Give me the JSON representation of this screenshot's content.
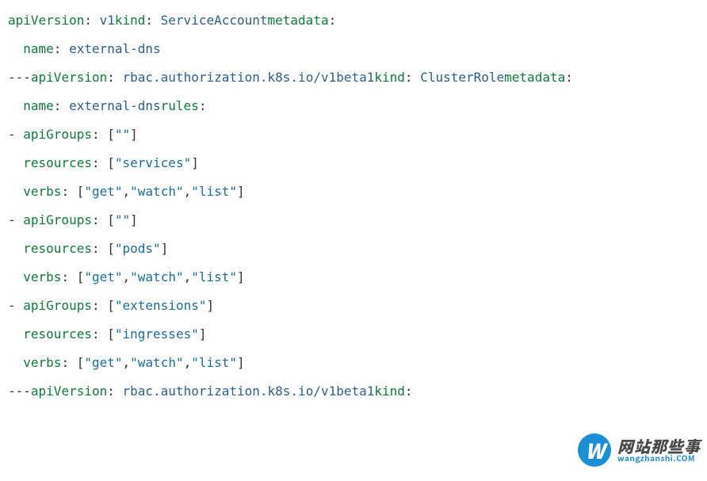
{
  "code": {
    "line1": {
      "k1": "apiVersion",
      "c1": ": ",
      "v1": "v1",
      "k2": "kind",
      "c2": ": ",
      "v2": "ServiceAccount",
      "k3": "metadata",
      "c3": ":"
    },
    "line2": {
      "pad": "  ",
      "k1": "name",
      "c1": ": ",
      "v1": "external-dns"
    },
    "line3": {
      "dash": "---",
      "k1": "apiVersion",
      "c1": ": ",
      "v1": "rbac.authorization.k8s.io/v1beta1",
      "k2": "kind",
      "c2": ": ",
      "v2": "ClusterRole",
      "k3": "metadata",
      "c3": ":"
    },
    "line4": {
      "pad": "  ",
      "k1": "name",
      "c1": ": ",
      "v1": "external-dns",
      "k2": "rules",
      "c2": ":"
    },
    "line5": {
      "dash": "- ",
      "k1": "apiGroups",
      "c1": ": ",
      "b1": "[",
      "s1": "\"\"",
      "b2": "]"
    },
    "line6": {
      "pad": "  ",
      "k1": "resources",
      "c1": ": ",
      "b1": "[",
      "s1": "\"services\"",
      "b2": "]"
    },
    "line7": {
      "pad": "  ",
      "k1": "verbs",
      "c1": ": ",
      "b1": "[",
      "s1": "\"get\"",
      "cm1": ",",
      "s2": "\"watch\"",
      "cm2": ",",
      "s3": "\"list\"",
      "b2": "]"
    },
    "line8": {
      "dash": "- ",
      "k1": "apiGroups",
      "c1": ": ",
      "b1": "[",
      "s1": "\"\"",
      "b2": "]"
    },
    "line9": {
      "pad": "  ",
      "k1": "resources",
      "c1": ": ",
      "b1": "[",
      "s1": "\"pods\"",
      "b2": "]"
    },
    "line10": {
      "pad": "  ",
      "k1": "verbs",
      "c1": ": ",
      "b1": "[",
      "s1": "\"get\"",
      "cm1": ",",
      "s2": "\"watch\"",
      "cm2": ",",
      "s3": "\"list\"",
      "b2": "]"
    },
    "line11": {
      "dash": "- ",
      "k1": "apiGroups",
      "c1": ": ",
      "b1": "[",
      "s1": "\"extensions\"",
      "b2": "]"
    },
    "line12": {
      "pad": "  ",
      "k1": "resources",
      "c1": ": ",
      "b1": "[",
      "s1": "\"ingresses\"",
      "b2": "]"
    },
    "line13": {
      "pad": "  ",
      "k1": "verbs",
      "c1": ": ",
      "b1": "[",
      "s1": "\"get\"",
      "cm1": ",",
      "s2": "\"watch\"",
      "cm2": ",",
      "s3": "\"list\"",
      "b2": "]"
    },
    "line14": {
      "dash": "---",
      "k1": "apiVersion",
      "c1": ": ",
      "v1": "rbac.authorization.k8s.io/v1beta1",
      "k2": "kind",
      "c2": ":"
    }
  },
  "watermark": {
    "badge_letter": "W",
    "title_cn": "网站那些事",
    "domain_en": "wangzhanshi.COM"
  }
}
